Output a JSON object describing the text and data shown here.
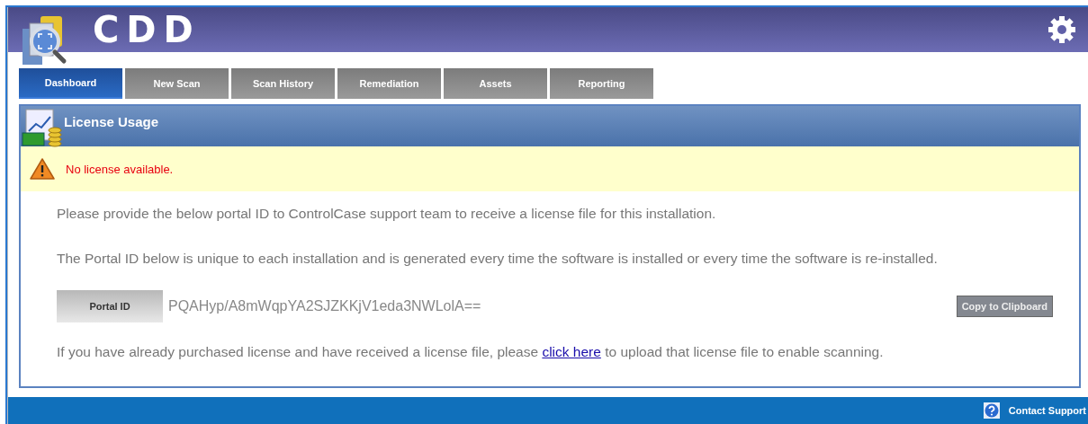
{
  "header": {
    "logo_text": "CDD"
  },
  "tabs": [
    {
      "label": "Dashboard",
      "selected": true
    },
    {
      "label": "New Scan",
      "selected": false
    },
    {
      "label": "Scan History",
      "selected": false
    },
    {
      "label": "Remediation",
      "selected": false
    },
    {
      "label": "Assets",
      "selected": false
    },
    {
      "label": "Reporting",
      "selected": false
    }
  ],
  "panel": {
    "title": "License Usage",
    "alert": "No license available.",
    "instructions": [
      "Please provide the below portal ID to ControlCase support team to receive a license file for this installation.",
      "The Portal ID below is unique to each installation and is generated every time the software is installed or every time the software is re-installed."
    ],
    "portal_id": {
      "label": "Portal ID",
      "value": "PQAHyp/A8mWqpYA2SJZKKjV1eda3NWLolA==",
      "button": "Copy to Clipboard"
    },
    "upload_note": {
      "before": "If you have already purchased license and have received a license file, please",
      "link": "click here",
      "after": "to upload that license file to enable scanning."
    }
  },
  "footer": {
    "contact": "Contact Support"
  }
}
